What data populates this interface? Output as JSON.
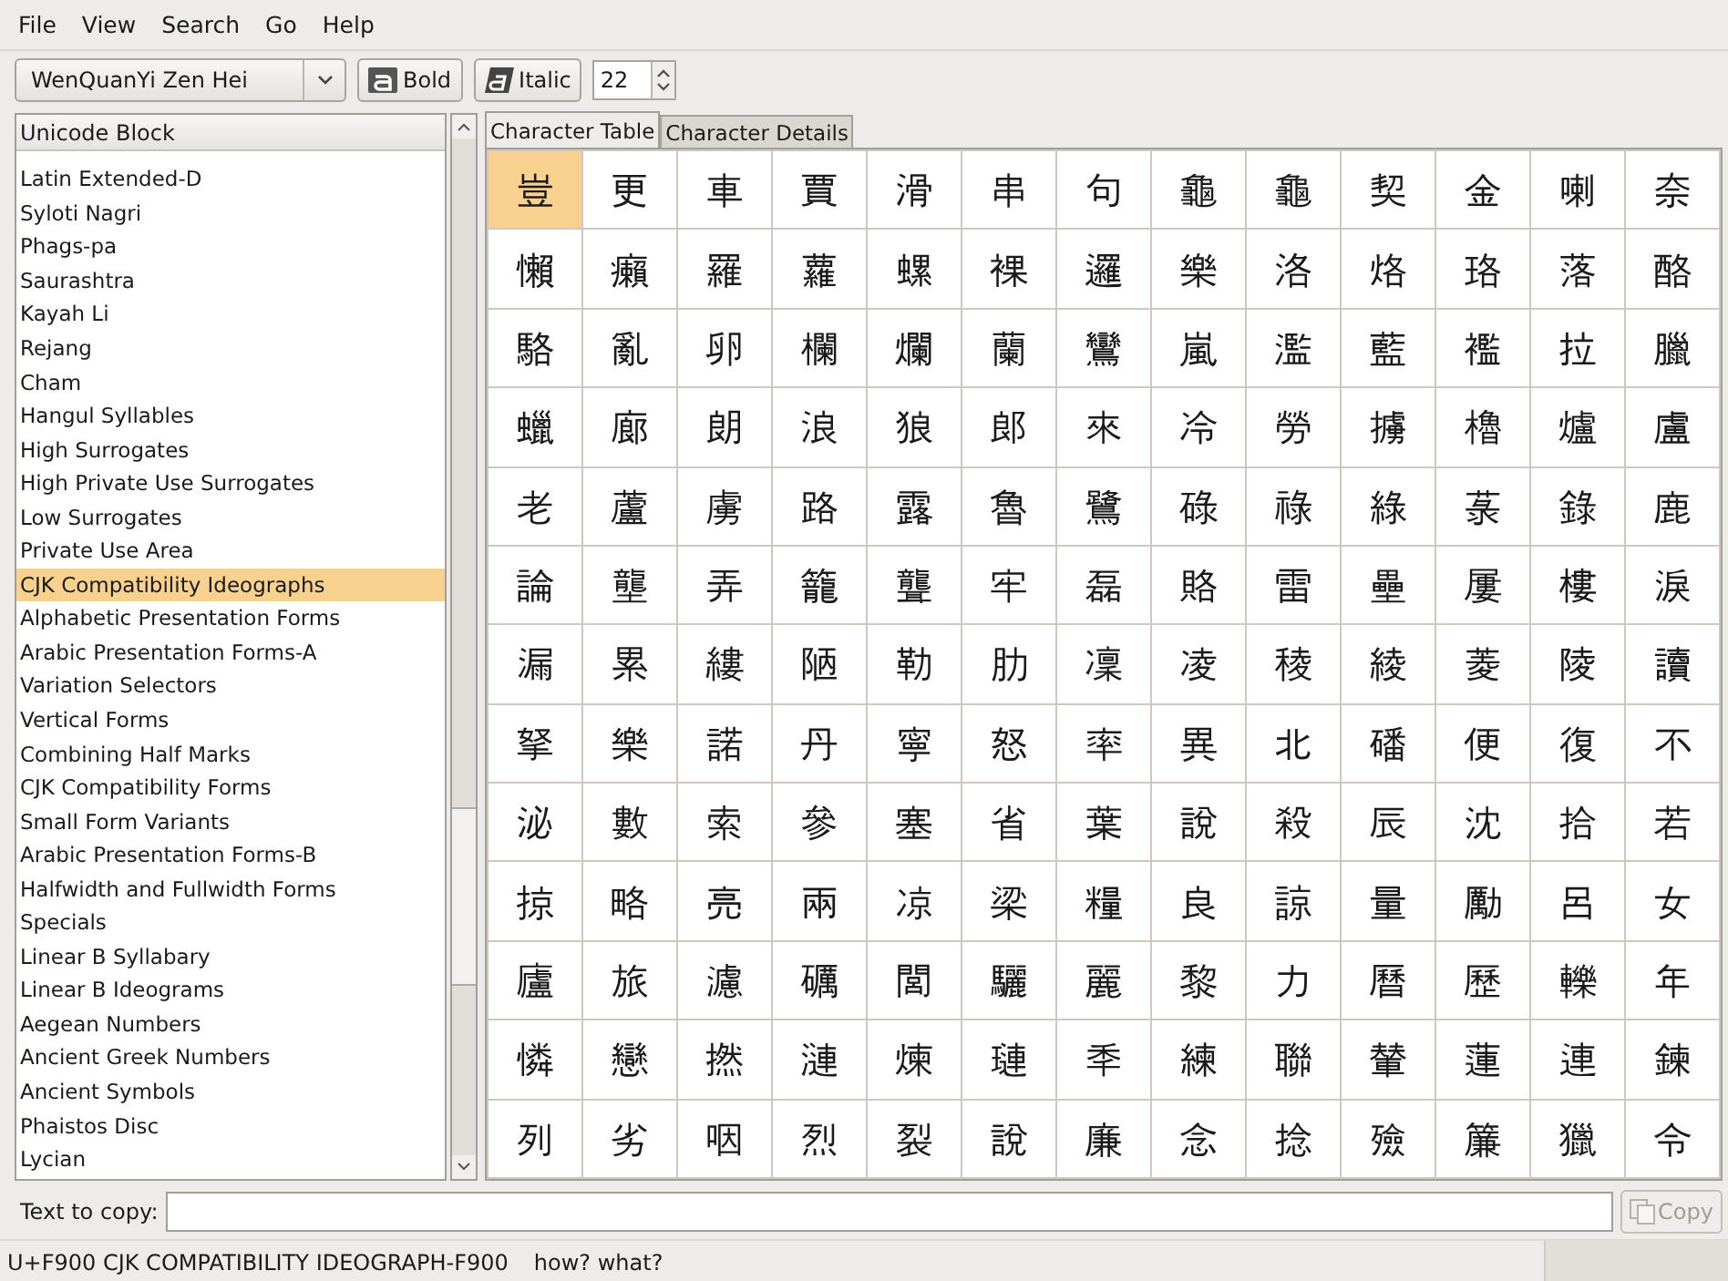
{
  "menu": [
    {
      "label": "File"
    },
    {
      "label": "View"
    },
    {
      "label": "Search"
    },
    {
      "label": "Go"
    },
    {
      "label": "Help"
    }
  ],
  "toolbar": {
    "font": "WenQuanYi Zen Hei",
    "bold": "Bold",
    "italic": "Italic",
    "size": "22"
  },
  "blocks": {
    "header": "Unicode Block",
    "items": [
      {
        "label": "Latin Extended-D",
        "selected": false
      },
      {
        "label": "Syloti Nagri",
        "selected": false
      },
      {
        "label": "Phags-pa",
        "selected": false
      },
      {
        "label": "Saurashtra",
        "selected": false
      },
      {
        "label": "Kayah Li",
        "selected": false
      },
      {
        "label": "Rejang",
        "selected": false
      },
      {
        "label": "Cham",
        "selected": false
      },
      {
        "label": "Hangul Syllables",
        "selected": false
      },
      {
        "label": "High Surrogates",
        "selected": false
      },
      {
        "label": "High Private Use Surrogates",
        "selected": false
      },
      {
        "label": "Low Surrogates",
        "selected": false
      },
      {
        "label": "Private Use Area",
        "selected": false
      },
      {
        "label": "CJK Compatibility Ideographs",
        "selected": true
      },
      {
        "label": "Alphabetic Presentation Forms",
        "selected": false
      },
      {
        "label": "Arabic Presentation Forms-A",
        "selected": false
      },
      {
        "label": "Variation Selectors",
        "selected": false
      },
      {
        "label": "Vertical Forms",
        "selected": false
      },
      {
        "label": "Combining Half Marks",
        "selected": false
      },
      {
        "label": "CJK Compatibility Forms",
        "selected": false
      },
      {
        "label": "Small Form Variants",
        "selected": false
      },
      {
        "label": "Arabic Presentation Forms-B",
        "selected": false
      },
      {
        "label": "Halfwidth and Fullwidth Forms",
        "selected": false
      },
      {
        "label": "Specials",
        "selected": false
      },
      {
        "label": "Linear B Syllabary",
        "selected": false
      },
      {
        "label": "Linear B Ideograms",
        "selected": false
      },
      {
        "label": "Aegean Numbers",
        "selected": false
      },
      {
        "label": "Ancient Greek Numbers",
        "selected": false
      },
      {
        "label": "Ancient Symbols",
        "selected": false
      },
      {
        "label": "Phaistos Disc",
        "selected": false
      },
      {
        "label": "Lycian",
        "selected": false
      }
    ]
  },
  "tabs": [
    {
      "label": "Character Table",
      "selected": true
    },
    {
      "label": "Character Details",
      "selected": false
    }
  ],
  "characters": [
    {
      "char": "豈",
      "selected": true
    },
    {
      "char": "更",
      "selected": false
    },
    {
      "char": "車",
      "selected": false
    },
    {
      "char": "賈",
      "selected": false
    },
    {
      "char": "滑",
      "selected": false
    },
    {
      "char": "串",
      "selected": false
    },
    {
      "char": "句",
      "selected": false
    },
    {
      "char": "龜",
      "selected": false
    },
    {
      "char": "龜",
      "selected": false
    },
    {
      "char": "契",
      "selected": false
    },
    {
      "char": "金",
      "selected": false
    },
    {
      "char": "喇",
      "selected": false
    },
    {
      "char": "奈",
      "selected": false
    },
    {
      "char": "懶",
      "selected": false
    },
    {
      "char": "癩",
      "selected": false
    },
    {
      "char": "羅",
      "selected": false
    },
    {
      "char": "蘿",
      "selected": false
    },
    {
      "char": "螺",
      "selected": false
    },
    {
      "char": "裸",
      "selected": false
    },
    {
      "char": "邏",
      "selected": false
    },
    {
      "char": "樂",
      "selected": false
    },
    {
      "char": "洛",
      "selected": false
    },
    {
      "char": "烙",
      "selected": false
    },
    {
      "char": "珞",
      "selected": false
    },
    {
      "char": "落",
      "selected": false
    },
    {
      "char": "酪",
      "selected": false
    },
    {
      "char": "駱",
      "selected": false
    },
    {
      "char": "亂",
      "selected": false
    },
    {
      "char": "卵",
      "selected": false
    },
    {
      "char": "欄",
      "selected": false
    },
    {
      "char": "爛",
      "selected": false
    },
    {
      "char": "蘭",
      "selected": false
    },
    {
      "char": "鸞",
      "selected": false
    },
    {
      "char": "嵐",
      "selected": false
    },
    {
      "char": "濫",
      "selected": false
    },
    {
      "char": "藍",
      "selected": false
    },
    {
      "char": "襤",
      "selected": false
    },
    {
      "char": "拉",
      "selected": false
    },
    {
      "char": "臘",
      "selected": false
    },
    {
      "char": "蠟",
      "selected": false
    },
    {
      "char": "廊",
      "selected": false
    },
    {
      "char": "朗",
      "selected": false
    },
    {
      "char": "浪",
      "selected": false
    },
    {
      "char": "狼",
      "selected": false
    },
    {
      "char": "郎",
      "selected": false
    },
    {
      "char": "來",
      "selected": false
    },
    {
      "char": "冷",
      "selected": false
    },
    {
      "char": "勞",
      "selected": false
    },
    {
      "char": "擄",
      "selected": false
    },
    {
      "char": "櫓",
      "selected": false
    },
    {
      "char": "爐",
      "selected": false
    },
    {
      "char": "盧",
      "selected": false
    },
    {
      "char": "老",
      "selected": false
    },
    {
      "char": "蘆",
      "selected": false
    },
    {
      "char": "虜",
      "selected": false
    },
    {
      "char": "路",
      "selected": false
    },
    {
      "char": "露",
      "selected": false
    },
    {
      "char": "魯",
      "selected": false
    },
    {
      "char": "鷺",
      "selected": false
    },
    {
      "char": "碌",
      "selected": false
    },
    {
      "char": "祿",
      "selected": false
    },
    {
      "char": "綠",
      "selected": false
    },
    {
      "char": "菉",
      "selected": false
    },
    {
      "char": "錄",
      "selected": false
    },
    {
      "char": "鹿",
      "selected": false
    },
    {
      "char": "論",
      "selected": false
    },
    {
      "char": "壟",
      "selected": false
    },
    {
      "char": "弄",
      "selected": false
    },
    {
      "char": "籠",
      "selected": false
    },
    {
      "char": "聾",
      "selected": false
    },
    {
      "char": "牢",
      "selected": false
    },
    {
      "char": "磊",
      "selected": false
    },
    {
      "char": "賂",
      "selected": false
    },
    {
      "char": "雷",
      "selected": false
    },
    {
      "char": "壘",
      "selected": false
    },
    {
      "char": "屢",
      "selected": false
    },
    {
      "char": "樓",
      "selected": false
    },
    {
      "char": "淚",
      "selected": false
    },
    {
      "char": "漏",
      "selected": false
    },
    {
      "char": "累",
      "selected": false
    },
    {
      "char": "縷",
      "selected": false
    },
    {
      "char": "陋",
      "selected": false
    },
    {
      "char": "勒",
      "selected": false
    },
    {
      "char": "肋",
      "selected": false
    },
    {
      "char": "凜",
      "selected": false
    },
    {
      "char": "凌",
      "selected": false
    },
    {
      "char": "稜",
      "selected": false
    },
    {
      "char": "綾",
      "selected": false
    },
    {
      "char": "菱",
      "selected": false
    },
    {
      "char": "陵",
      "selected": false
    },
    {
      "char": "讀",
      "selected": false
    },
    {
      "char": "拏",
      "selected": false
    },
    {
      "char": "樂",
      "selected": false
    },
    {
      "char": "諾",
      "selected": false
    },
    {
      "char": "丹",
      "selected": false
    },
    {
      "char": "寧",
      "selected": false
    },
    {
      "char": "怒",
      "selected": false
    },
    {
      "char": "率",
      "selected": false
    },
    {
      "char": "異",
      "selected": false
    },
    {
      "char": "北",
      "selected": false
    },
    {
      "char": "磻",
      "selected": false
    },
    {
      "char": "便",
      "selected": false
    },
    {
      "char": "復",
      "selected": false
    },
    {
      "char": "不",
      "selected": false
    },
    {
      "char": "泌",
      "selected": false
    },
    {
      "char": "數",
      "selected": false
    },
    {
      "char": "索",
      "selected": false
    },
    {
      "char": "參",
      "selected": false
    },
    {
      "char": "塞",
      "selected": false
    },
    {
      "char": "省",
      "selected": false
    },
    {
      "char": "葉",
      "selected": false
    },
    {
      "char": "說",
      "selected": false
    },
    {
      "char": "殺",
      "selected": false
    },
    {
      "char": "辰",
      "selected": false
    },
    {
      "char": "沈",
      "selected": false
    },
    {
      "char": "拾",
      "selected": false
    },
    {
      "char": "若",
      "selected": false
    },
    {
      "char": "掠",
      "selected": false
    },
    {
      "char": "略",
      "selected": false
    },
    {
      "char": "亮",
      "selected": false
    },
    {
      "char": "兩",
      "selected": false
    },
    {
      "char": "凉",
      "selected": false
    },
    {
      "char": "梁",
      "selected": false
    },
    {
      "char": "糧",
      "selected": false
    },
    {
      "char": "良",
      "selected": false
    },
    {
      "char": "諒",
      "selected": false
    },
    {
      "char": "量",
      "selected": false
    },
    {
      "char": "勵",
      "selected": false
    },
    {
      "char": "呂",
      "selected": false
    },
    {
      "char": "女",
      "selected": false
    },
    {
      "char": "廬",
      "selected": false
    },
    {
      "char": "旅",
      "selected": false
    },
    {
      "char": "濾",
      "selected": false
    },
    {
      "char": "礪",
      "selected": false
    },
    {
      "char": "閭",
      "selected": false
    },
    {
      "char": "驪",
      "selected": false
    },
    {
      "char": "麗",
      "selected": false
    },
    {
      "char": "黎",
      "selected": false
    },
    {
      "char": "力",
      "selected": false
    },
    {
      "char": "曆",
      "selected": false
    },
    {
      "char": "歷",
      "selected": false
    },
    {
      "char": "轢",
      "selected": false
    },
    {
      "char": "年",
      "selected": false
    },
    {
      "char": "憐",
      "selected": false
    },
    {
      "char": "戀",
      "selected": false
    },
    {
      "char": "撚",
      "selected": false
    },
    {
      "char": "漣",
      "selected": false
    },
    {
      "char": "煉",
      "selected": false
    },
    {
      "char": "璉",
      "selected": false
    },
    {
      "char": "秊",
      "selected": false
    },
    {
      "char": "練",
      "selected": false
    },
    {
      "char": "聯",
      "selected": false
    },
    {
      "char": "輦",
      "selected": false
    },
    {
      "char": "蓮",
      "selected": false
    },
    {
      "char": "連",
      "selected": false
    },
    {
      "char": "鍊",
      "selected": false
    },
    {
      "char": "列",
      "selected": false
    },
    {
      "char": "劣",
      "selected": false
    },
    {
      "char": "咽",
      "selected": false
    },
    {
      "char": "烈",
      "selected": false
    },
    {
      "char": "裂",
      "selected": false
    },
    {
      "char": "說",
      "selected": false
    },
    {
      "char": "廉",
      "selected": false
    },
    {
      "char": "念",
      "selected": false
    },
    {
      "char": "捻",
      "selected": false
    },
    {
      "char": "殮",
      "selected": false
    },
    {
      "char": "簾",
      "selected": false
    },
    {
      "char": "獵",
      "selected": false
    },
    {
      "char": "令",
      "selected": false
    }
  ],
  "copy": {
    "label": "Text to copy:",
    "button": {
      "label": "Copy",
      "disabled": true
    }
  },
  "status_bar": {
    "name": "U+F900 CJK COMPATIBILITY IDEOGRAPH-F900",
    "note": "how? what?"
  }
}
